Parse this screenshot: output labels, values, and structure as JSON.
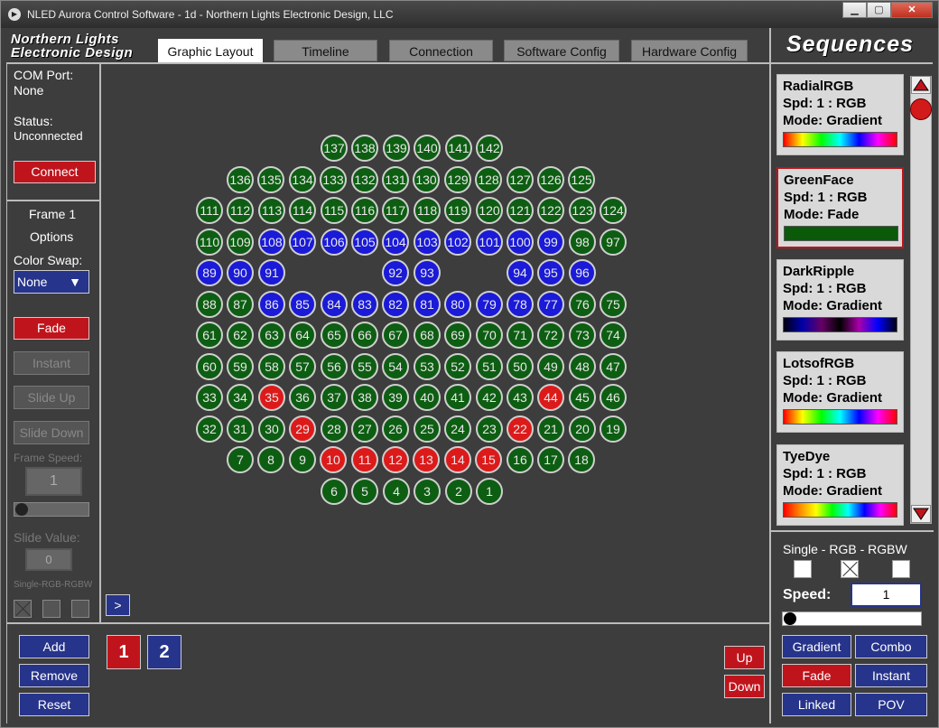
{
  "window": {
    "title": "NLED Aurora Control Software - 1d - Northern Lights Electronic Design, LLC"
  },
  "logo": {
    "line1": "Northern Lights",
    "line2": "Electronic Design"
  },
  "tabs": [
    "Graphic Layout",
    "Timeline",
    "Connection",
    "Software Config",
    "Hardware Config"
  ],
  "left": {
    "com_label": "COM Port:",
    "com_value": "None",
    "status_label": "Status:",
    "status_value": "Unconnected",
    "connect": "Connect",
    "frame": "Frame 1",
    "options": "Options",
    "color_swap": "Color Swap:",
    "swap_value": "None",
    "fade": "Fade",
    "instant": "Instant",
    "slide_up": "Slide Up",
    "slide_down": "Slide Down",
    "frame_speed": "Frame Speed:",
    "frame_speed_value": "1",
    "slide_value_label": "Slide Value:",
    "slide_value": "0",
    "single_rgb": "Single-RGB-RGBW",
    "expand": ">"
  },
  "bottom": {
    "add": "Add",
    "remove": "Remove",
    "reset": "Reset",
    "page1": "1",
    "page2": "2",
    "up": "Up",
    "down": "Down"
  },
  "leds": {
    "rows": [
      [
        "137",
        "138",
        "139",
        "140",
        "141",
        "142"
      ],
      [
        "136",
        "135",
        "134",
        "133",
        "132",
        "131",
        "130",
        "129",
        "128",
        "127",
        "126",
        "125"
      ],
      [
        "111",
        "112",
        "113",
        "114",
        "115",
        "116",
        "117",
        "118",
        "119",
        "120",
        "121",
        "122",
        "123",
        "124"
      ],
      [
        "110",
        "109",
        "108",
        "107",
        "106",
        "105",
        "104",
        "103",
        "102",
        "101",
        "100",
        "99",
        "98",
        "97"
      ],
      [
        "89",
        "90",
        "91",
        "92",
        "93",
        "94",
        "95",
        "96"
      ],
      [
        "88",
        "87",
        "86",
        "85",
        "84",
        "83",
        "82",
        "81",
        "80",
        "79",
        "78",
        "77",
        "76",
        "75"
      ],
      [
        "61",
        "62",
        "63",
        "64",
        "65",
        "66",
        "67",
        "68",
        "69",
        "70",
        "71",
        "72",
        "73",
        "74"
      ],
      [
        "60",
        "59",
        "58",
        "57",
        "56",
        "55",
        "54",
        "53",
        "52",
        "51",
        "50",
        "49",
        "48",
        "47"
      ],
      [
        "33",
        "34",
        "35",
        "36",
        "37",
        "38",
        "39",
        "40",
        "41",
        "42",
        "43",
        "44",
        "45",
        "46"
      ],
      [
        "32",
        "31",
        "30",
        "29",
        "28",
        "27",
        "26",
        "25",
        "24",
        "23",
        "22",
        "21",
        "20",
        "19"
      ],
      [
        "7",
        "8",
        "9",
        "10",
        "11",
        "12",
        "13",
        "14",
        "15",
        "16",
        "17",
        "18"
      ],
      [
        "6",
        "5",
        "4",
        "3",
        "2",
        "1"
      ]
    ],
    "blue": [
      "108",
      "107",
      "106",
      "105",
      "104",
      "103",
      "102",
      "101",
      "100",
      "99",
      "89",
      "90",
      "91",
      "92",
      "93",
      "94",
      "95",
      "96",
      "86",
      "85",
      "84",
      "83",
      "82",
      "81",
      "80",
      "79",
      "78",
      "77"
    ],
    "red": [
      "35",
      "44",
      "29",
      "22",
      "10",
      "11",
      "12",
      "13",
      "14",
      "15"
    ]
  },
  "sequences": {
    "title": "Sequences",
    "items": [
      {
        "name": "RadialRGB",
        "spd": "Spd: 1 : RGB",
        "mode": "Mode: Gradient",
        "bar": "linear-gradient(90deg,#f00,#ff0,#0f0,#0ff,#00f,#f0f,#f00)"
      },
      {
        "name": "GreenFace",
        "spd": "Spd: 1 : RGB",
        "mode": "Mode: Fade",
        "bar": "#0a5a0a"
      },
      {
        "name": "DarkRipple",
        "spd": "Spd: 1 : RGB",
        "mode": "Mode: Gradient",
        "bar": "linear-gradient(90deg,#001,#00a,#606,#000,#a0a,#00f,#001)"
      },
      {
        "name": "LotsofRGB",
        "spd": "Spd: 1 : RGB",
        "mode": "Mode: Gradient",
        "bar": "linear-gradient(90deg,#f00,#ff0,#0f0,#0ff,#00f,#f0f,#f00)"
      },
      {
        "name": "TyeDye",
        "spd": "Spd: 1 : RGB",
        "mode": "Mode: Gradient",
        "bar": "linear-gradient(90deg,#f00,#f80,#ff0,#0f0,#0ff,#00f,#f0f,#f00)"
      }
    ],
    "type_label": "Single - RGB - RGBW",
    "speed_label": "Speed:",
    "speed_value": "1",
    "gradient": "Gradient",
    "combo": "Combo",
    "fade": "Fade",
    "instant": "Instant",
    "linked": "Linked",
    "pov": "POV"
  }
}
